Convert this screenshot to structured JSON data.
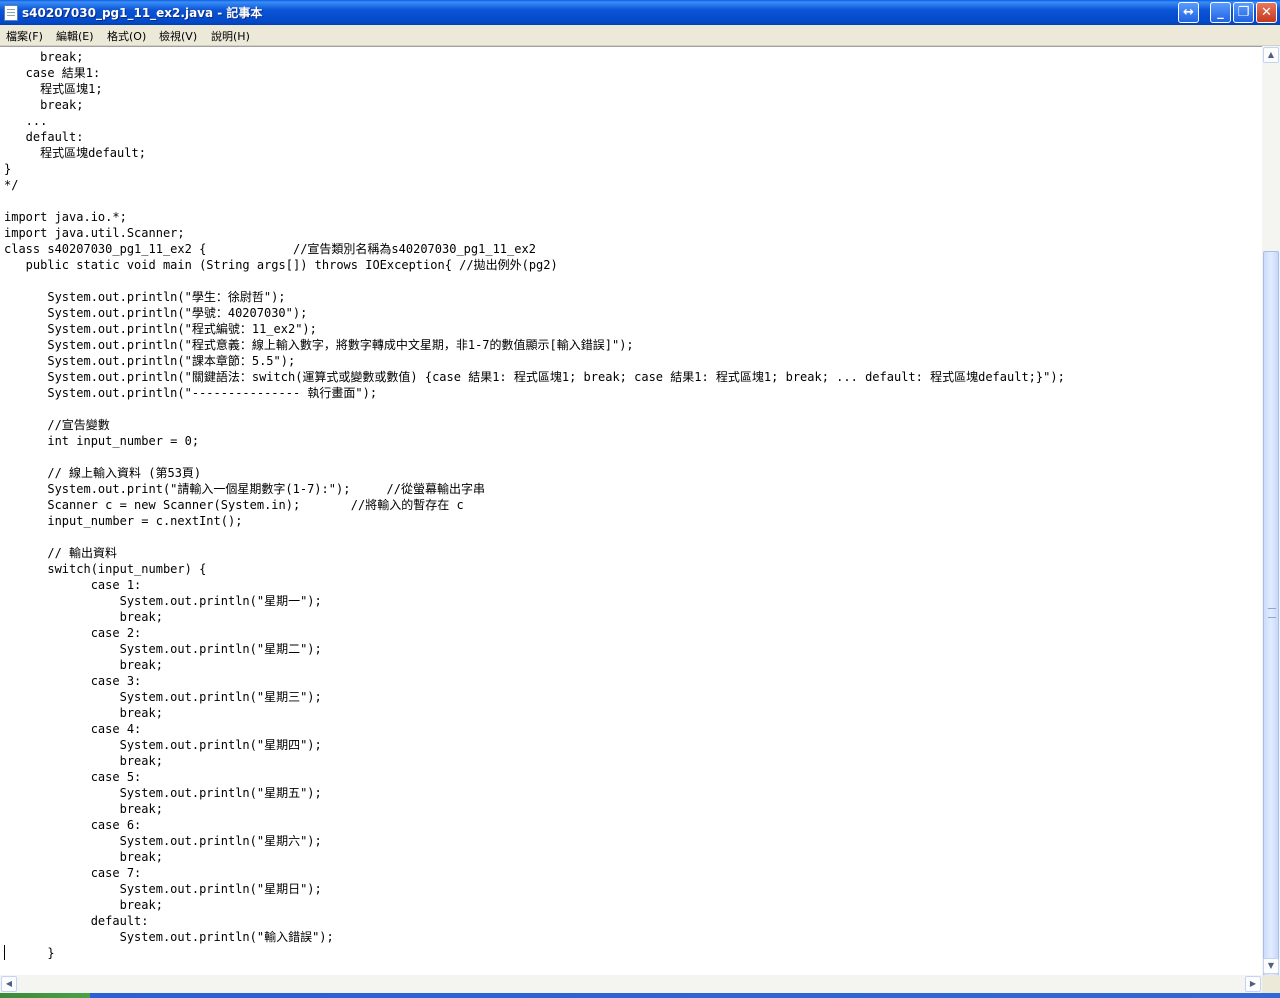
{
  "window": {
    "title": "s40207030_pg1_11_ex2.java - 記事本",
    "buttons": {
      "resize": "↔",
      "minimize": "_",
      "maximize": "❐",
      "close": "✕"
    }
  },
  "menu": [
    "檔案(F)",
    "編輯(E)",
    "格式(O)",
    "檢視(V)",
    "說明(H)"
  ],
  "editor": {
    "lines": [
      "     break;",
      "   case 結果1:",
      "     程式區塊1;",
      "     break;",
      "   ...",
      "   default:",
      "     程式區塊default;",
      "}",
      "*/",
      "",
      "import java.io.*;",
      "import java.util.Scanner;",
      "class s40207030_pg1_11_ex2 {            //宣告類別名稱為s40207030_pg1_11_ex2",
      "   public static void main (String args[]) throws IOException{ //拋出例外(pg2)",
      "",
      "      System.out.println(\"學生：徐尉哲\");",
      "      System.out.println(\"學號：40207030\");",
      "      System.out.println(\"程式編號：11_ex2\");",
      "      System.out.println(\"程式意義：線上輸入數字，將數字轉成中文星期，非1-7的數值顯示[輸入錯誤]\");",
      "      System.out.println(\"課本章節：5.5\");",
      "      System.out.println(\"關鍵語法：switch(運算式或變數或數值) {case 結果1: 程式區塊1; break; case 結果1: 程式區塊1; break; ... default: 程式區塊default;}\");",
      "      System.out.println(\"--------------- 執行畫面\");",
      "",
      "      //宣告變數",
      "      int input_number = 0;",
      "",
      "      // 線上輸入資料 (第53頁)",
      "      System.out.print(\"請輸入一個星期數字(1-7):\");     //從螢幕輸出字串",
      "      Scanner c = new Scanner(System.in);       //將輸入的暫存在 c",
      "      input_number = c.nextInt();",
      "",
      "      // 輸出資料",
      "      switch(input_number) {",
      "            case 1:",
      "                System.out.println(\"星期一\");",
      "                break;",
      "            case 2:",
      "                System.out.println(\"星期二\");",
      "                break;",
      "            case 3:",
      "                System.out.println(\"星期三\");",
      "                break;",
      "            case 4:",
      "                System.out.println(\"星期四\");",
      "                break;",
      "            case 5:",
      "                System.out.println(\"星期五\");",
      "                break;",
      "            case 6:",
      "                System.out.println(\"星期六\");",
      "                break;",
      "            case 7:",
      "                System.out.println(\"星期日\");",
      "                break;",
      "            default:",
      "                System.out.println(\"輸入錯誤\");",
      "      }"
    ]
  },
  "scrollbars": {
    "vertical_position": 0.21,
    "vertical_visible": 0.81,
    "arrows": {
      "up": "▲",
      "down": "▼",
      "left": "◀",
      "right": "▶"
    }
  }
}
